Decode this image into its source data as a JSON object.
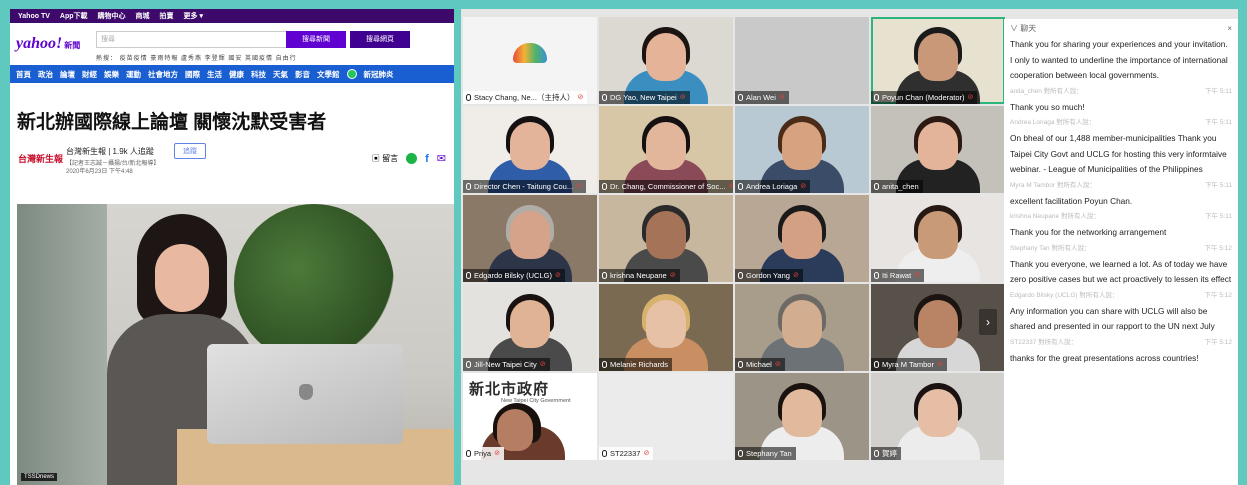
{
  "colors": {
    "frame": "#5fc9bf",
    "yahoo_purple": "#6001d2",
    "yahoo_nav": "#1a5fd1",
    "chat_bg": "#ffffff",
    "active_speaker": "#2bb47c"
  },
  "yahoo": {
    "top_links": [
      "Yahoo TV",
      "App下載",
      "購物中心",
      "商城",
      "拍賣",
      "更多 ▾"
    ],
    "logo": "yahoo!",
    "logo_sub": "新聞",
    "search_placeholder": "搜尋",
    "search_news_btn": "搜尋新聞",
    "search_web_btn": "搜尋網頁",
    "sub_links": "熱搜：  疫苗疫情  豪雨特報  盧秀燕  李登輝  國安  英國疫情  自由行",
    "nav_tabs": [
      "首頁",
      "政治",
      "論壇",
      "財經",
      "娛樂",
      "運動",
      "社會地方",
      "國際",
      "生活",
      "健康",
      "科技",
      "天氣",
      "影音",
      "文學館",
      "新冠肺炎"
    ],
    "headline": "新北辦國際線上論壇 關懷沈默受害者",
    "source_logo": "台灣新生報",
    "author": "台灣新生報  |  1.9k 人追蹤",
    "follow_btn": "追蹤",
    "date_line1": "【記者王志誠－攝揚/台/新北報導】",
    "date_line2": "2020年6月23日 下午4:48",
    "comment_label": "留言",
    "share_icons": [
      "line-icon",
      "facebook-icon",
      "mail-icon"
    ],
    "photo_tag": "TSSDnews"
  },
  "zoom": {
    "participants": [
      {
        "name": "Stacy Chang, Ne...（主持人）",
        "type": "logo",
        "muted": true
      },
      {
        "name": "DG Yao, New Taipei",
        "type": "person",
        "muted": true,
        "bg": "#dcd8d2",
        "skin": "#e4b398",
        "hair": "#1c1411",
        "shirt": "#3b8fc0"
      },
      {
        "name": "Alan Wei",
        "type": "blank",
        "muted": true
      },
      {
        "name": "Poyun Chan (Moderator)",
        "type": "person",
        "muted": true,
        "active": true,
        "bg": "#e7e1cf",
        "skin": "#c99878",
        "hair": "#1a1a1a",
        "shirt": "#2f2f2f"
      },
      {
        "name": "Director Chen - Taitung Cou...",
        "type": "person",
        "muted": true,
        "bg": "#f0ede8",
        "skin": "#e3b49a",
        "hair": "#151011",
        "shirt": "#2f5da8"
      },
      {
        "name": "Dr. Chang, Commissioner of Soc...",
        "type": "person",
        "muted": true,
        "bg": "#d7c7a6",
        "skin": "#e2b69a",
        "hair": "#151011",
        "shirt": "#8b4a57"
      },
      {
        "name": "Andrea Loriaga",
        "type": "person",
        "muted": true,
        "bg": "#b9c9d4",
        "skin": "#d7a27f",
        "hair": "#4b2c19",
        "shirt": "#3a4c68"
      },
      {
        "name": "anita_chen",
        "type": "person",
        "muted": false,
        "bg": "#c4c0ba",
        "skin": "#e4b49a",
        "hair": "#2c1a12",
        "shirt": "#222222"
      },
      {
        "name": "Edgardo Bilsky (UCLG)",
        "type": "person",
        "muted": true,
        "bg": "#8b7968",
        "skin": "#d4a389",
        "hair": "#b1aca6",
        "shirt": "#2d3548"
      },
      {
        "name": "krishna Neupane",
        "type": "person",
        "muted": true,
        "bg": "#c6b79e",
        "skin": "#a57357",
        "hair": "#2a2a2a",
        "shirt": "#4a4a4a"
      },
      {
        "name": "Gordon Yang",
        "type": "person",
        "muted": true,
        "bg": "#b7a794",
        "skin": "#d3a084",
        "hair": "#1a1a1a",
        "shirt": "#2b3b5a"
      },
      {
        "name": "Iti Rawat",
        "type": "person",
        "muted": true,
        "bg": "#e7e4e2",
        "skin": "#c99a78",
        "hair": "#261812",
        "shirt": "#eeeeee"
      },
      {
        "name": "Jill-New Taipei City",
        "type": "person",
        "muted": true,
        "bg": "#e4e2df",
        "skin": "#e0b394",
        "hair": "#1a1210",
        "shirt": "#4a4a4a"
      },
      {
        "name": "Melanie Richards",
        "type": "person",
        "muted": false,
        "bg": "#7b6a52",
        "skin": "#e6c1a6",
        "hair": "#d8b16c",
        "shirt": "#c98e62"
      },
      {
        "name": "Michael",
        "type": "person",
        "muted": true,
        "bg": "#a89c8b",
        "skin": "#d3ad8f",
        "hair": "#6d6a66",
        "shirt": "#6d7277"
      },
      {
        "name": "Myra M Tambor",
        "type": "person",
        "muted": true,
        "bg": "#585149",
        "skin": "#b98466",
        "hair": "#1b1411",
        "shirt": "#d7d7d7"
      },
      {
        "name": "Priya",
        "type": "ntpc",
        "muted": true,
        "bg": "#ffffff",
        "skin": "#b57d61",
        "hair": "#18110e",
        "shirt": "#6a3b2c"
      },
      {
        "name": "ST22337",
        "type": "blank2",
        "muted": true
      },
      {
        "name": "Stephany Tan",
        "type": "person",
        "muted": false,
        "bg": "#9c9486",
        "skin": "#e1b99c",
        "hair": "#1a120f",
        "shirt": "#ededed"
      },
      {
        "name": "賀婷",
        "type": "person",
        "muted": false,
        "bg": "#d2d0cc",
        "skin": "#e6bea5",
        "hair": "#1a1210",
        "shirt": "#ececec"
      }
    ],
    "ntpc_logo": "新北市政府",
    "ntpc_sub": "New Taipei City Government",
    "chat": {
      "title": "∨ 聊天",
      "close": "×",
      "messages": [
        {
          "text": "Thank you for sharing your experiences and your invitation. I only to wanted to underline the importance of international cooperation between local governments."
        },
        {
          "sender": "anita_chen 對所有人說：",
          "time": "下午 5:11",
          "text": "Thank you so much!"
        },
        {
          "sender": "Andrea Loriaga 對所有人說：",
          "time": "下午 5:11",
          "text": "On bheal of our 1,488 member-municipalities Thank you Taipei City Govt and UCLG for hosting this very informtaive webinar. - League of Municipalities of the Philippines"
        },
        {
          "sender": "Myra M Tambor 對所有人說：",
          "time": "下午 5:11",
          "text": "excellent facilitation Poyun Chan."
        },
        {
          "sender": "krishna Neupane 對所有人說：",
          "time": "下午 5:11",
          "text": "Thank you for the networking arrangement"
        },
        {
          "sender": "Stephany Tan 對所有人說：",
          "time": "下午 5:12",
          "text": "Thank you everyone, we learned a lot. As of today we have zero positive cases but we act proactively to lessen its effect"
        },
        {
          "sender": "Edgardo Bilsky (UCLG) 對所有人說：",
          "time": "下午 5:12",
          "text": "Any information you can share with UCLG will also be shared and presented in our rapport to the UN next July"
        },
        {
          "sender": "ST22337 對所有人說：",
          "time": "下午 5:12",
          "text": "thanks for the great presentations across countries!"
        }
      ]
    }
  }
}
